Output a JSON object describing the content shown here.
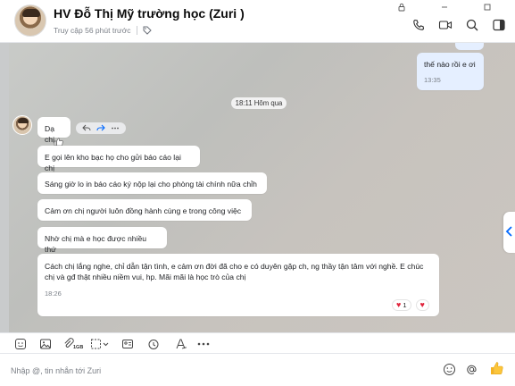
{
  "header": {
    "title": "HV Đỗ Thị Mỹ trường học (Zuri )",
    "last_access": "Truy cập 56 phút trước",
    "icons": [
      "phone-icon",
      "video-icon",
      "search-icon",
      "panel-icon"
    ]
  },
  "chat": {
    "outgoing": {
      "text": "thế  nào rồi e ơi",
      "time": "13:35"
    },
    "date_divider": "18:11 Hôm qua",
    "incoming": [
      "Dạ chị",
      "E gọi lên kho bạc họ cho gửi báo cáo lại chị",
      "Sáng giờ lo in báo cáo ký nộp lại cho phòng tài chính nữa chỉh",
      "Cảm ơn chị người luôn đồng hành cùng e trong công việc",
      "Nhờ chị mà e học được nhiều thứ"
    ],
    "last_message": {
      "text": "Cách chị lắng nghe, chỉ dẫn tận tình, e cảm ơn đời đã cho e có duyên gặp ch, ng thầy tận tâm với nghề. E chúc chị và gđ thật nhiều niềm vui, hp. Mãi mãi là học trò của chị",
      "time": "18:26",
      "reaction_count": "1"
    }
  },
  "toolbar": {
    "file_limit": "1GB"
  },
  "input": {
    "placeholder": "Nhập @, tin nhắn tới Zuri"
  },
  "colors": {
    "accent": "#0068ff",
    "outgoing_bubble": "#e5efff",
    "heart": "#e0243c"
  }
}
